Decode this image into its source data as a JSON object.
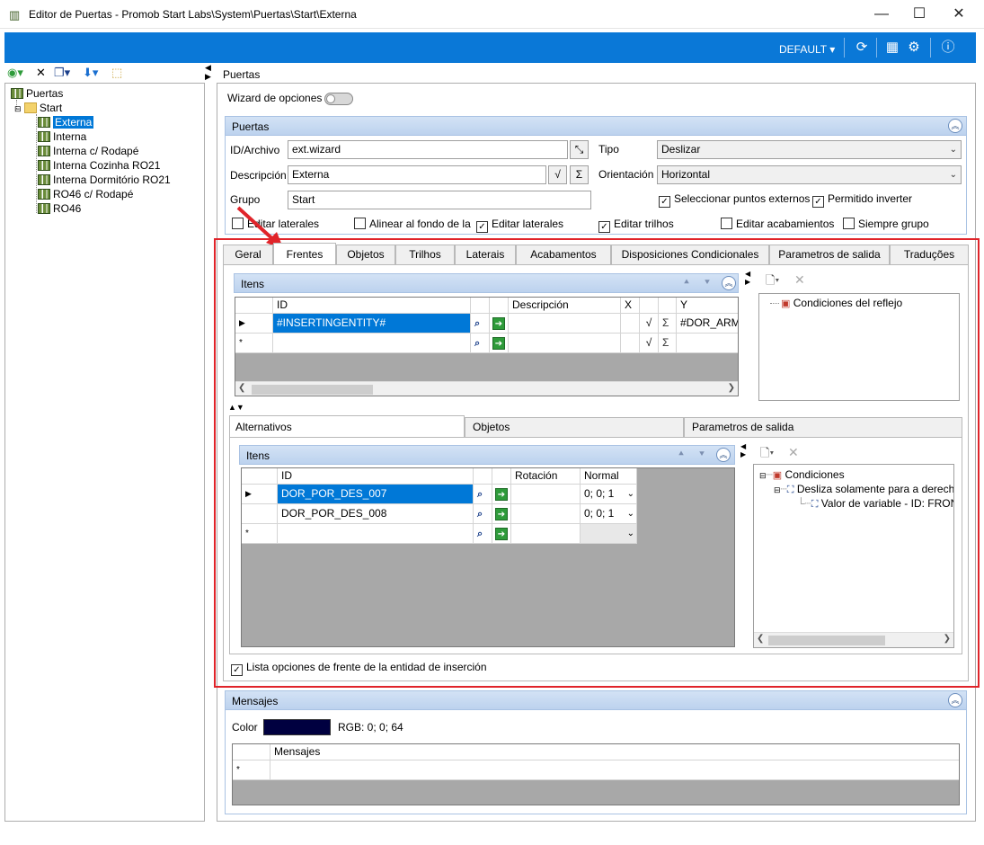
{
  "window": {
    "title": "Editor de Puertas - Promob Start Labs\\System\\Puertas\\Start\\Externa"
  },
  "ribbon": {
    "profile": "DEFAULT"
  },
  "tree": {
    "root": "Puertas",
    "folder": "Start",
    "items": [
      "Externa",
      "Interna",
      "Interna c/ Rodapé",
      "Interna Cozinha RO21",
      "Interna Dormitório RO21",
      "RO46 c/ Rodapé",
      "RO46"
    ]
  },
  "main": {
    "header": "Puertas",
    "wizard_label": "Wizard de opciones",
    "group_title": "Puertas",
    "id_label": "ID/Archivo",
    "id_value": "ext.wizard",
    "desc_label": "Descripción",
    "desc_value": "Externa",
    "grupo_label": "Grupo",
    "grupo_value": "Start",
    "tipo_label": "Tipo",
    "tipo_value": "Deslizar",
    "orient_label": "Orientación",
    "orient_value": "Horizontal",
    "checks_right": [
      "Seleccionar puntos externos",
      "Permitido inverter"
    ],
    "checks_row": [
      {
        "label": "Editar laterales",
        "checked": false
      },
      {
        "label": "Alinear al fondo de la",
        "checked": false
      },
      {
        "label": "Editar laterales",
        "checked": true
      },
      {
        "label": "Editar trilhos",
        "checked": true
      },
      {
        "label": "Editar acabamientos",
        "checked": false
      },
      {
        "label": "Siempre grupo",
        "checked": false
      }
    ]
  },
  "tabs": [
    "Geral",
    "Frentes",
    "Objetos",
    "Trilhos",
    "Laterais",
    "Acabamentos",
    "Disposiciones Condicionales",
    "Parametros de salida",
    "Traduções"
  ],
  "frentes": {
    "items_title": "Itens",
    "columns": [
      "ID",
      "Descripción",
      "X",
      "Y"
    ],
    "rows": [
      {
        "id": "#INSERTINGENTITY#",
        "y": "#DOR_ARM_"
      }
    ],
    "right_tree": [
      "Condiciones del reflejo"
    ]
  },
  "subtabs": [
    "Alternativos",
    "Objetos",
    "Parametros de salida"
  ],
  "alternativos": {
    "items_title": "Itens",
    "columns": [
      "ID",
      "Rotación",
      "Normal"
    ],
    "rows": [
      {
        "id": "DOR_POR_DES_007",
        "normal": "0; 0; 1"
      },
      {
        "id": "DOR_POR_DES_008",
        "normal": "0; 0; 1"
      }
    ],
    "right_tree": [
      "Condiciones",
      "Desliza solamente para a derecha",
      "Valor de variable - ID: FRONT"
    ]
  },
  "lista_check": "Lista opciones de frente de la entidad de inserción",
  "mensajes": {
    "title": "Mensajes",
    "color_label": "Color",
    "rgb": "RGB: 0; 0; 64",
    "column": "Mensajes"
  }
}
